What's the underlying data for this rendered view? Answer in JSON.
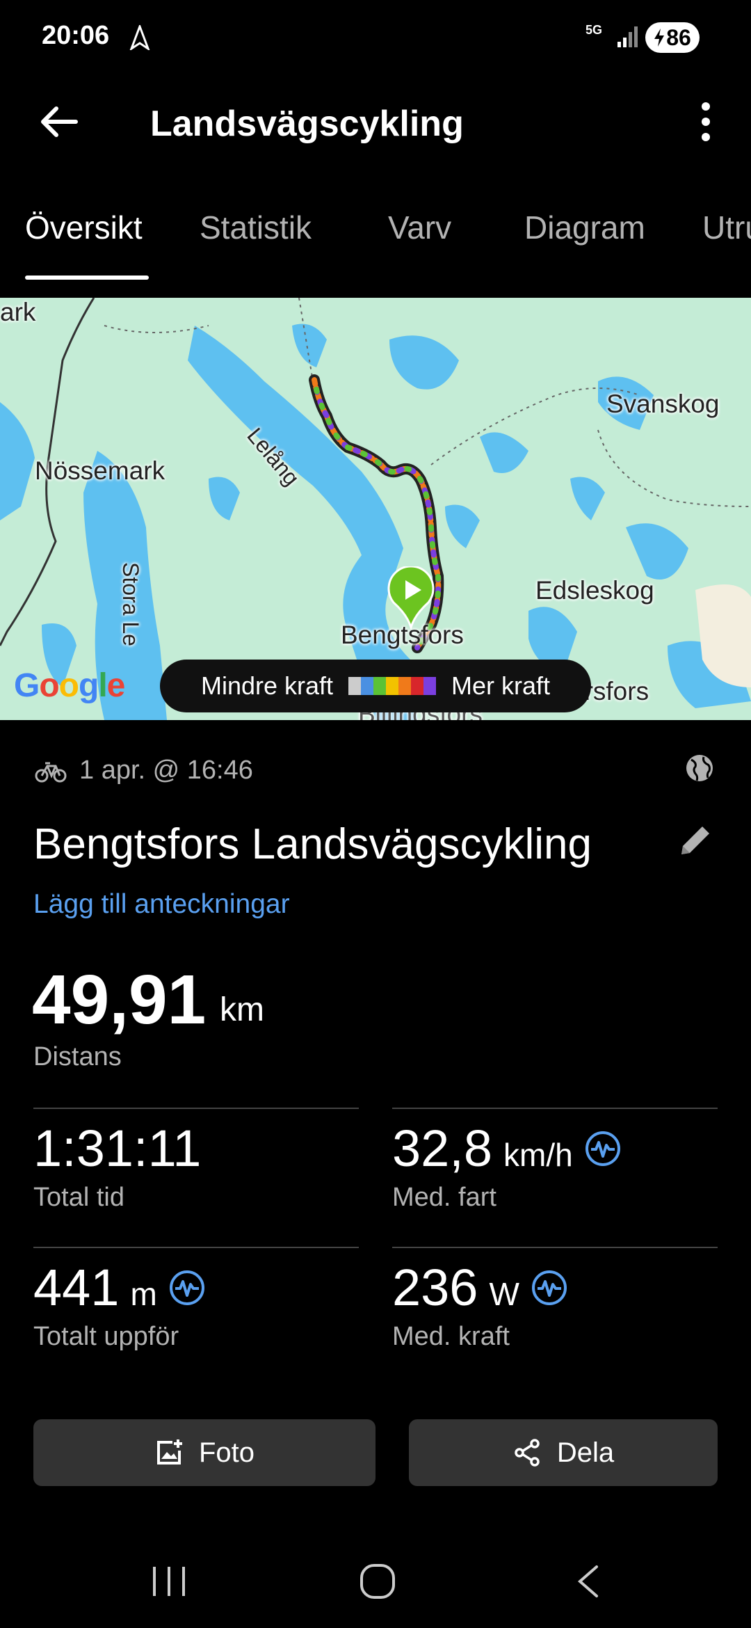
{
  "status_bar": {
    "time": "20:06",
    "network": "5G",
    "battery": "86"
  },
  "header": {
    "title": "Landsvägscykling"
  },
  "tabs": [
    {
      "label": "Översikt",
      "active": true
    },
    {
      "label": "Statistik",
      "active": false
    },
    {
      "label": "Varv",
      "active": false
    },
    {
      "label": "Diagram",
      "active": false
    },
    {
      "label": "Utru",
      "active": false
    }
  ],
  "map": {
    "labels": {
      "ark": "ark",
      "nossemark": "Nössemark",
      "svanskog": "Svanskog",
      "lelang": "Lelång",
      "stora_le": "Stora Le",
      "edsleskog": "Edsleskog",
      "bengtsfors": "Bengtsfors",
      "ersfors": "ersfors",
      "dalings": "Billingsfors"
    },
    "attribution": "Google",
    "legend": {
      "low_label": "Mindre kraft",
      "high_label": "Mer kraft",
      "colors": [
        "#cccccc",
        "#4a90e2",
        "#5bc236",
        "#f2c200",
        "#f07a1a",
        "#d8262b",
        "#7b3fe0"
      ]
    }
  },
  "activity": {
    "date": "1 apr. @ 16:46",
    "title": "Bengtsfors Landsvägscykling",
    "add_notes": "Lägg till anteckningar"
  },
  "distance": {
    "value": "49,91",
    "unit": "km",
    "label": "Distans"
  },
  "stats": {
    "total_time": {
      "value": "1:31:11",
      "label": "Total tid"
    },
    "avg_speed": {
      "value": "32,8",
      "unit": "km/h",
      "label": "Med. fart"
    },
    "ascent": {
      "value": "441",
      "unit": "m",
      "label": "Totalt uppför"
    },
    "avg_power": {
      "value": "236",
      "unit": "W",
      "label": "Med. kraft"
    }
  },
  "actions": {
    "photo": "Foto",
    "share": "Dela"
  },
  "colors": {
    "accent": "#5aa0f0",
    "button_bg": "#333333",
    "map_land": "#c4ecd6",
    "map_water": "#5ec0f0"
  }
}
